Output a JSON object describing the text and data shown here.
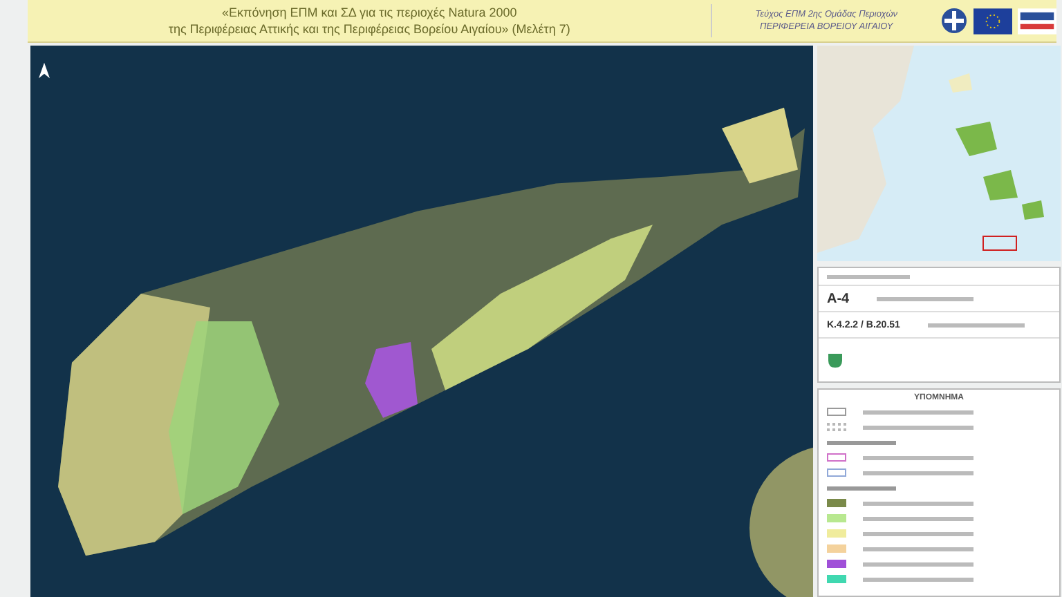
{
  "header": {
    "title_lines": [
      "«Εκπόνηση ΕΠΜ και ΣΔ για τις περιοχές Natura 2000",
      "της Περιφέρειας Αττικής και της Περιφέρειας Βορείου Αιγαίου» (Μελέτη 7)"
    ],
    "subtitle_lines": [
      "Τεύχος ΕΠΜ 2ης Ομάδας Περιοχών",
      "ΠΕΡΙΦΕΡΕΙΑ ΒΟΡΕΙΟΥ ΑΙΓΑΙΟΥ"
    ]
  },
  "info_table": {
    "sheet": "Α-4",
    "code": "Κ.4.2.2 / Β.20.51"
  },
  "legend": {
    "title": "ΥΠΟΜΝΗΜΑ",
    "items": [
      {
        "kind": "outline",
        "color": "#9a9a9a"
      },
      {
        "kind": "hatch",
        "color": "#b8b8b8"
      },
      {
        "kind": "heading"
      },
      {
        "kind": "outline",
        "color": "#d070c8"
      },
      {
        "kind": "outline",
        "color": "#90a8d8"
      },
      {
        "kind": "heading"
      },
      {
        "kind": "fill",
        "color": "#7a8a4a"
      },
      {
        "kind": "fill",
        "color": "#b8e890"
      },
      {
        "kind": "fill",
        "color": "#f0ec9c"
      },
      {
        "kind": "fill",
        "color": "#f4d29c"
      },
      {
        "kind": "fill",
        "color": "#a050d8"
      },
      {
        "kind": "fill",
        "color": "#40d8b0"
      }
    ]
  }
}
